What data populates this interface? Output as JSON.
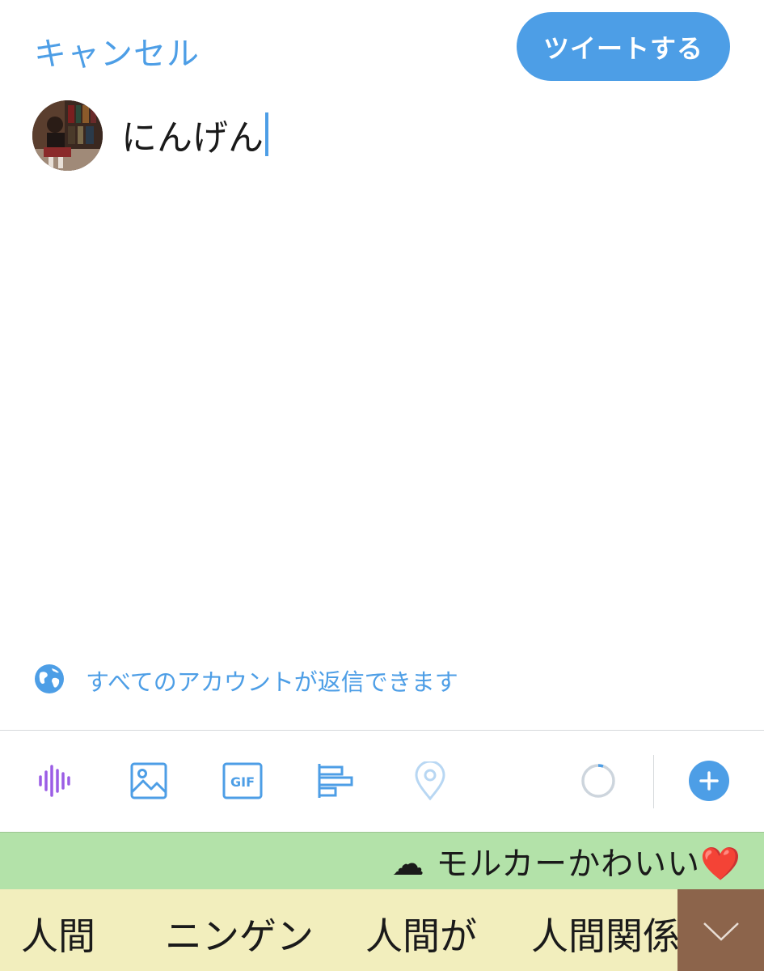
{
  "header": {
    "cancel_label": "キャンセル",
    "tweet_label": "ツイートする"
  },
  "compose": {
    "text": "にんげん"
  },
  "reply_setting": {
    "label": "すべてのアカウントが返信できます",
    "icon": "globe-icon"
  },
  "toolbar": {
    "items": [
      "voice-icon",
      "image-icon",
      "gif-icon",
      "poll-icon",
      "location-icon",
      "char-count-ring",
      "add-thread-icon"
    ],
    "gif_text": "GIF"
  },
  "keyboard": {
    "suggestion": "☁ モルカーかわいい❤️",
    "candidates": [
      "人間",
      "ニンゲン",
      "人間が",
      "人間関係"
    ]
  },
  "colors": {
    "accent": "#4d9ee6",
    "voice": "#9b5de5",
    "suggestion_bg": "#b3e2a9",
    "candidates_bg": "#f2eebd",
    "expand_bg": "#8c644b"
  }
}
